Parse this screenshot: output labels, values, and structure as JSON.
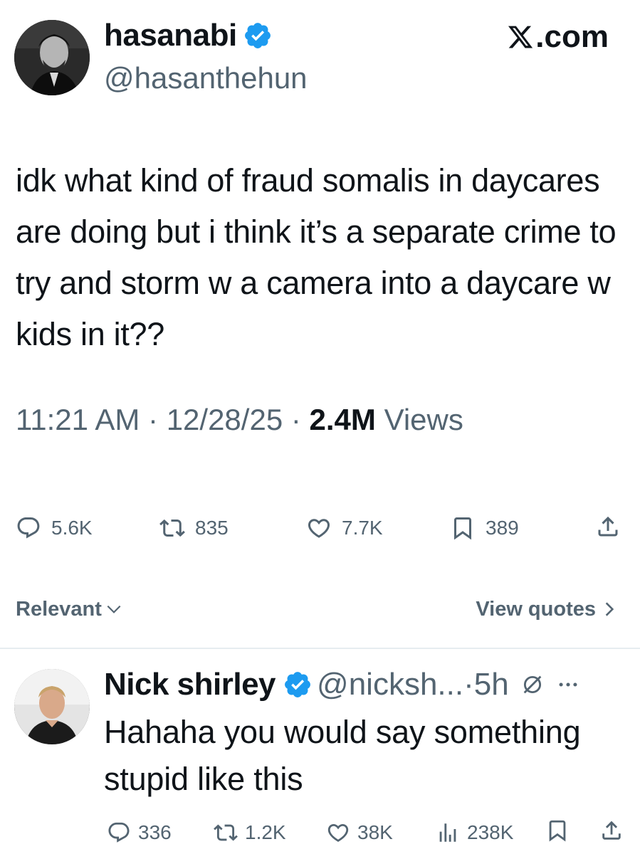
{
  "brand": {
    "label": ".com"
  },
  "tweet": {
    "author_name": "hasanabi",
    "author_handle": "@hasanthehun",
    "text": "idk what kind of fraud somalis in daycares are doing but i think it’s a separate crime to try and storm w a camera into a daycare w kids in it??",
    "time": "11:21 AM",
    "date": "12/28/25",
    "separator": "·",
    "views_count": "2.4M",
    "views_label": "Views",
    "actions": {
      "replies": "5.6K",
      "reposts": "835",
      "likes": "7.7K",
      "bookmarks": "389"
    }
  },
  "sort": {
    "label": "Relevant"
  },
  "view_quotes": {
    "label": "View quotes"
  },
  "reply": {
    "author_name": "Nick shirley",
    "author_handle": "@nicksh...",
    "separator": "·",
    "time": "5h",
    "text": "Hahaha you would say something stupid like this",
    "actions": {
      "replies": "336",
      "reposts": "1.2K",
      "likes": "38K",
      "views": "238K"
    }
  },
  "colors": {
    "text_primary": "#0f1419",
    "text_secondary": "#536471",
    "verified_blue": "#1d9bf0",
    "divider": "#e6ecf0"
  },
  "icons": [
    "verified-badge-icon",
    "x-logo-icon",
    "reply-icon",
    "repost-icon",
    "like-icon",
    "bookmark-icon",
    "share-icon",
    "chevron-down-icon",
    "chevron-right-icon",
    "grok-icon",
    "more-icon",
    "views-icon"
  ]
}
